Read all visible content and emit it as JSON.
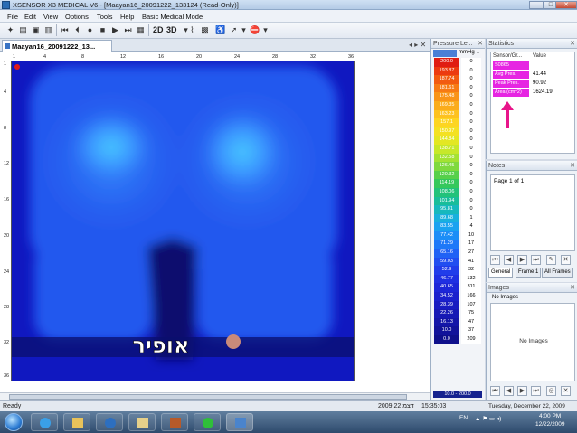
{
  "window": {
    "title": "XSENSOR X3 MEDICAL V6 - [Maayan16_20091222_133124 (Read-Only)]",
    "minimize_glyph": "–",
    "maximize_glyph": "□",
    "close_glyph": "✕"
  },
  "menu": [
    "File",
    "Edit",
    "View",
    "Options",
    "Tools",
    "Help",
    "Basic Medical Mode"
  ],
  "toolbar": {
    "view_2d_label": "2D",
    "view_3d_label": "3D"
  },
  "document_tab": {
    "label": "Maayan16_20091222_13...",
    "controls": "◂ ▸ ✕"
  },
  "heatmap": {
    "column_labels": [
      "1",
      "4",
      "8",
      "12",
      "16",
      "20",
      "24",
      "28",
      "32",
      "36"
    ],
    "row_labels": [
      "1",
      "4",
      "8",
      "12",
      "16",
      "20",
      "24",
      "28",
      "32",
      "36"
    ],
    "hebrew_text": "אופיר",
    "colors": {
      "background": "#1018c0",
      "medium": "#2458ee",
      "high": "#3a95ff",
      "peak": "#48c6ff",
      "dark": "#0a0f6e",
      "marker": "#c98a7a",
      "origin_dot": "#e01919"
    }
  },
  "pressure_legend": {
    "title": "Pressure Le...",
    "unit": "mmHg",
    "rows": [
      {
        "value": "200.0",
        "count": "0",
        "color": "#e01d12"
      },
      {
        "value": "193.87",
        "count": "0",
        "color": "#ec3a10"
      },
      {
        "value": "187.74",
        "count": "0",
        "color": "#f25a10"
      },
      {
        "value": "181.61",
        "count": "0",
        "color": "#f77a14"
      },
      {
        "value": "175.48",
        "count": "0",
        "color": "#f99418"
      },
      {
        "value": "169.35",
        "count": "0",
        "color": "#fbac1c"
      },
      {
        "value": "163.23",
        "count": "0",
        "color": "#fdc21f"
      },
      {
        "value": "157.1",
        "count": "0",
        "color": "#fdd522"
      },
      {
        "value": "150.97",
        "count": "0",
        "color": "#f4e122"
      },
      {
        "value": "144.84",
        "count": "0",
        "color": "#e3e723"
      },
      {
        "value": "138.71",
        "count": "0",
        "color": "#c7e82a"
      },
      {
        "value": "132.58",
        "count": "0",
        "color": "#a4e233"
      },
      {
        "value": "126.45",
        "count": "0",
        "color": "#7fd93e"
      },
      {
        "value": "120.32",
        "count": "0",
        "color": "#56d04a"
      },
      {
        "value": "114.19",
        "count": "0",
        "color": "#35c85c"
      },
      {
        "value": "108.06",
        "count": "0",
        "color": "#22c27a"
      },
      {
        "value": "101.94",
        "count": "0",
        "color": "#19bd9a"
      },
      {
        "value": "95.81",
        "count": "0",
        "color": "#17b8bd"
      },
      {
        "value": "89.68",
        "count": "1",
        "color": "#19b0dd"
      },
      {
        "value": "83.55",
        "count": "4",
        "color": "#1aa2f0"
      },
      {
        "value": "77.42",
        "count": "10",
        "color": "#1c8ef7"
      },
      {
        "value": "71.29",
        "count": "17",
        "color": "#1e78f8"
      },
      {
        "value": "65.16",
        "count": "27",
        "color": "#2062f5"
      },
      {
        "value": "59.03",
        "count": "41",
        "color": "#214ef0"
      },
      {
        "value": "52.9",
        "count": "32",
        "color": "#213dea"
      },
      {
        "value": "46.77",
        "count": "132",
        "color": "#1f30e2"
      },
      {
        "value": "40.65",
        "count": "311",
        "color": "#1c27d8"
      },
      {
        "value": "34.52",
        "count": "166",
        "color": "#1a21cd"
      },
      {
        "value": "28.39",
        "count": "107",
        "color": "#181cc1"
      },
      {
        "value": "22.26",
        "count": "75",
        "color": "#1619b5"
      },
      {
        "value": "16.13",
        "count": "47",
        "color": "#1416a8"
      },
      {
        "value": "10.0",
        "count": "37",
        "color": "#12139a"
      },
      {
        "value": "0.0",
        "count": "209",
        "color": "#0f108b"
      }
    ],
    "range_label": "10.0 - 200.0"
  },
  "statistics": {
    "title": "Statistics",
    "col_sensor": "Sensor/Gr...",
    "col_value": "Value",
    "rows": [
      {
        "key": "S0865",
        "value": ""
      },
      {
        "key": "Avg Pres.",
        "value": "41.44"
      },
      {
        "key": "Peak Pres.",
        "value": "90.92"
      },
      {
        "key": "Area (cm^2)",
        "value": "1624.19"
      }
    ],
    "arrow_color": "#e8158a"
  },
  "notes": {
    "title": "Notes",
    "page_label": "Page 1 of 1",
    "tabs": [
      "General",
      "Frame 1",
      "All Frames"
    ]
  },
  "images": {
    "title": "Images",
    "header": "No Images",
    "empty_text": "No Images"
  },
  "status": {
    "left": "Ready",
    "date": "2009 22 דצמ",
    "time": "15:35:03"
  },
  "taskbar": {
    "lang": "EN",
    "clock_time": "4:00 PM",
    "clock_date": "12/22/2009"
  },
  "footer_date": "Tuesday, December 22, 2009"
}
